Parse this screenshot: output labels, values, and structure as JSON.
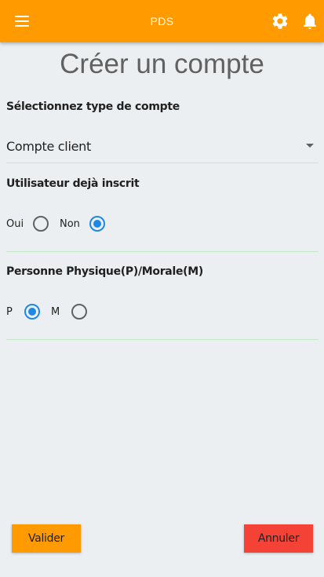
{
  "appbar": {
    "title": "PDS",
    "menu_icon": "menu-icon",
    "settings_icon": "gear-icon",
    "notifications_icon": "bell-icon",
    "color": "#ff9a00"
  },
  "page": {
    "title": "Créer un compte"
  },
  "account_type": {
    "label": "Sélectionnez type de compte",
    "selected": "Compte client"
  },
  "already_registered": {
    "label": "Utilisateur dejà inscrit",
    "options": [
      {
        "label": "Oui",
        "checked": false
      },
      {
        "label": "Non",
        "checked": true
      }
    ]
  },
  "person_type": {
    "label": "Personne  Physique(P)/Morale(M)",
    "options": [
      {
        "label": "P",
        "checked": true
      },
      {
        "label": "M",
        "checked": false
      }
    ]
  },
  "actions": {
    "submit_label": "Valider",
    "cancel_label": "Annuler",
    "submit_color": "#ff9a00",
    "cancel_color": "#f44336"
  }
}
